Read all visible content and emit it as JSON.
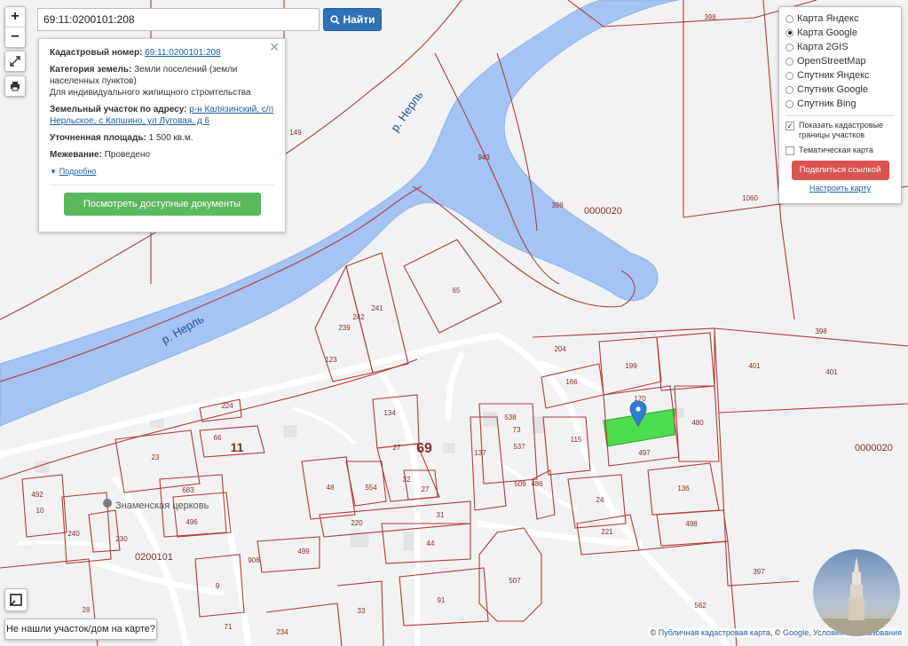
{
  "search": {
    "value": "69:11:0200101:208",
    "button_label": "Найти"
  },
  "zoom": {
    "plus": "+",
    "minus": "−"
  },
  "info": {
    "cad_label": "Кадастровый номер:",
    "cad_value": "69:11:0200101:208",
    "category_label": "Категория земель:",
    "category_value": "Земли поселений (земли населенных пунктов)",
    "use_value": "Для индивидуального жилищного строительства",
    "address_label": "Земельный участок по адресу:",
    "address_value": "р-н Калязинский, с/п Нерльское, с Капшино, ул Луговая, д 6",
    "area_label": "Уточненная площадь:",
    "area_value": "1 500 кв.м.",
    "survey_label": "Межевание:",
    "survey_value": "Проведено",
    "more_label": "Подробно",
    "docs_button": "Посмотреть доступные документы"
  },
  "layers": {
    "options": [
      "Карта Яндекс",
      "Карта Google",
      "Карта 2GIS",
      "OpenStreetMap",
      "Спутник Яндекс",
      "Спутник Google",
      "Спутник Bing"
    ],
    "selected_index": 1,
    "show_cadastral": "Показать кадастровые границы участков",
    "show_cadastral_checked": true,
    "thematic": "Тематическая карта",
    "thematic_checked": false,
    "share_button": "Поделиться ссылкой",
    "configure_link": "Настроить карту"
  },
  "map": {
    "river_labels": [
      "р. Нерль",
      "р. Нерль"
    ],
    "block_labels": [
      "69",
      "11"
    ],
    "church_label": "Знаменская церковь",
    "quarter_labels": [
      "0200101",
      "0000020",
      "0000020"
    ],
    "parcel_numbers": [
      "398",
      "149",
      "943",
      "398",
      "1060",
      "65",
      "241",
      "242",
      "239",
      "123",
      "204",
      "199",
      "166",
      "170",
      "480",
      "401",
      "401",
      "398",
      "224",
      "134",
      "66",
      "27",
      "538",
      "73",
      "537",
      "115",
      "497",
      "137",
      "509",
      "486",
      "23",
      "48",
      "554",
      "32",
      "27",
      "492",
      "683",
      "10",
      "240",
      "230",
      "496",
      "220",
      "31",
      "24",
      "136",
      "44",
      "221",
      "498",
      "499",
      "906",
      "9",
      "507",
      "397",
      "28",
      "33",
      "91",
      "71",
      "234",
      "562"
    ],
    "colors": {
      "water": "#a3c4f5",
      "land": "#f2f2f2",
      "boundary": "#b33a3a",
      "road": "#ffffff",
      "selected_parcel": "#4ddc4d",
      "marker": "#2b7fd1"
    }
  },
  "not_found_button": "Не нашли участок/дом на карте?",
  "attribution": {
    "prefix": "©",
    "pkk": "Публичная кадастровая карта",
    "sep": ", © ",
    "google": "Google",
    "terms": "Условия использования"
  }
}
